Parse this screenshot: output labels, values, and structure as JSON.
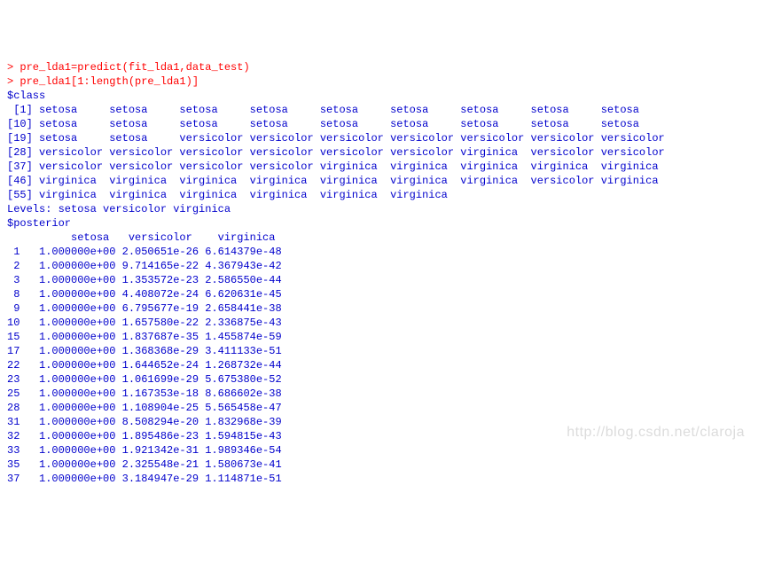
{
  "commands": {
    "line1": "> pre_lda1=predict(fit_lda1,data_test)",
    "line2": "> pre_lda1[1:length(pre_lda1)]"
  },
  "class_header": "$class",
  "class_matrix": {
    "indices": [
      " [1]",
      "[10]",
      "[19]",
      "[28]",
      "[37]",
      "[46]",
      "[55]"
    ],
    "rows": [
      [
        "setosa",
        "setosa",
        "setosa",
        "setosa",
        "setosa",
        "setosa",
        "setosa",
        "setosa",
        "setosa"
      ],
      [
        "setosa",
        "setosa",
        "setosa",
        "setosa",
        "setosa",
        "setosa",
        "setosa",
        "setosa",
        "setosa"
      ],
      [
        "setosa",
        "setosa",
        "versicolor",
        "versicolor",
        "versicolor",
        "versicolor",
        "versicolor",
        "versicolor",
        "versicolor"
      ],
      [
        "versicolor",
        "versicolor",
        "versicolor",
        "versicolor",
        "versicolor",
        "versicolor",
        "virginica",
        "versicolor",
        "versicolor"
      ],
      [
        "versicolor",
        "versicolor",
        "versicolor",
        "versicolor",
        "virginica",
        "virginica",
        "virginica",
        "virginica",
        "virginica"
      ],
      [
        "virginica",
        "virginica",
        "virginica",
        "virginica",
        "virginica",
        "virginica",
        "virginica",
        "versicolor",
        "virginica"
      ],
      [
        "virginica",
        "virginica",
        "virginica",
        "virginica",
        "virginica",
        "virginica"
      ]
    ]
  },
  "levels": "Levels: setosa versicolor virginica",
  "posterior_header": "$posterior",
  "posterior_colhdr": "          setosa   versicolor    virginica",
  "posterior_rows": [
    {
      "n": "1",
      "s": "1.000000e+00",
      "vc": "2.050651e-26",
      "vg": "6.614379e-48"
    },
    {
      "n": "2",
      "s": "1.000000e+00",
      "vc": "9.714165e-22",
      "vg": "4.367943e-42"
    },
    {
      "n": "3",
      "s": "1.000000e+00",
      "vc": "1.353572e-23",
      "vg": "2.586550e-44"
    },
    {
      "n": "8",
      "s": "1.000000e+00",
      "vc": "4.408072e-24",
      "vg": "6.620631e-45"
    },
    {
      "n": "9",
      "s": "1.000000e+00",
      "vc": "6.795677e-19",
      "vg": "2.658441e-38"
    },
    {
      "n": "10",
      "s": "1.000000e+00",
      "vc": "1.657580e-22",
      "vg": "2.336875e-43"
    },
    {
      "n": "15",
      "s": "1.000000e+00",
      "vc": "1.837687e-35",
      "vg": "1.455874e-59"
    },
    {
      "n": "17",
      "s": "1.000000e+00",
      "vc": "1.368368e-29",
      "vg": "3.411133e-51"
    },
    {
      "n": "22",
      "s": "1.000000e+00",
      "vc": "1.644652e-24",
      "vg": "1.268732e-44"
    },
    {
      "n": "23",
      "s": "1.000000e+00",
      "vc": "1.061699e-29",
      "vg": "5.675380e-52"
    },
    {
      "n": "25",
      "s": "1.000000e+00",
      "vc": "1.167353e-18",
      "vg": "8.686602e-38"
    },
    {
      "n": "28",
      "s": "1.000000e+00",
      "vc": "1.108904e-25",
      "vg": "5.565458e-47"
    },
    {
      "n": "31",
      "s": "1.000000e+00",
      "vc": "8.508294e-20",
      "vg": "1.832968e-39"
    },
    {
      "n": "32",
      "s": "1.000000e+00",
      "vc": "1.895486e-23",
      "vg": "1.594815e-43"
    },
    {
      "n": "33",
      "s": "1.000000e+00",
      "vc": "1.921342e-31",
      "vg": "1.989346e-54"
    },
    {
      "n": "35",
      "s": "1.000000e+00",
      "vc": "2.325548e-21",
      "vg": "1.580673e-41"
    },
    {
      "n": "37",
      "s": "1.000000e+00",
      "vc": "3.184947e-29",
      "vg": "1.114871e-51"
    }
  ],
  "watermark": "http://blog.csdn.net/claroja"
}
